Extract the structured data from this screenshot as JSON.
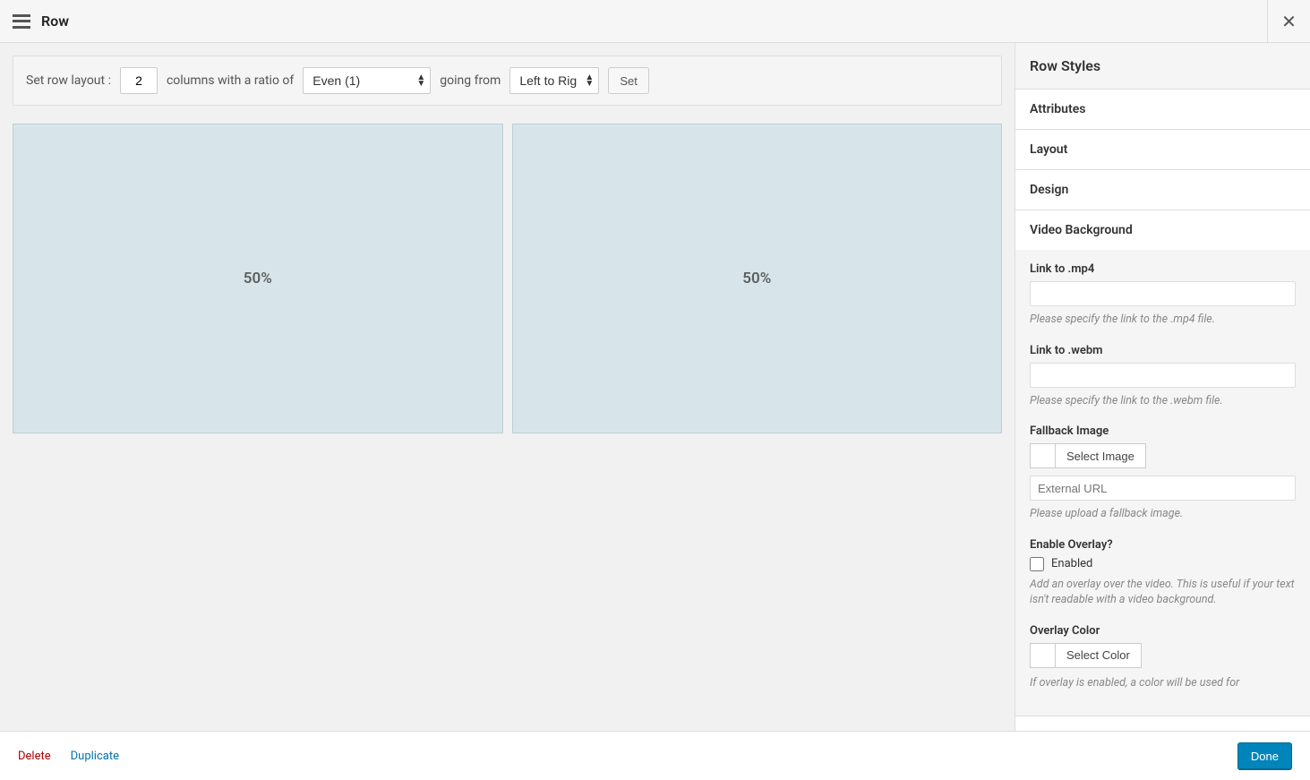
{
  "header": {
    "title": "Row"
  },
  "layoutBar": {
    "setLabel": "Set row layout :",
    "columnsValue": "2",
    "ratioText": "columns with a ratio of",
    "ratioSelected": "Even (1)",
    "goingText": "going from",
    "directionSelected": "Left to Right",
    "setButton": "Set"
  },
  "columns": [
    {
      "label": "50%"
    },
    {
      "label": "50%"
    }
  ],
  "sidebar": {
    "title": "Row Styles",
    "sections": {
      "attributes": "Attributes",
      "layout": "Layout",
      "design": "Design",
      "videoBg": "Video Background"
    },
    "videoBg": {
      "mp4": {
        "label": "Link to .mp4",
        "desc": "Please specify the link to the .mp4 file."
      },
      "webm": {
        "label": "Link to .webm",
        "desc": "Please specify the link to the .webm file."
      },
      "fallback": {
        "label": "Fallback Image",
        "selectBtn": "Select Image",
        "placeholder": "External URL",
        "desc": "Please upload a fallback image."
      },
      "overlay": {
        "label": "Enable Overlay?",
        "checkboxLabel": "Enabled",
        "desc": "Add an overlay over the video. This is useful if your text isn't readable with a video background."
      },
      "overlayColor": {
        "label": "Overlay Color",
        "selectBtn": "Select Color",
        "desc": "If overlay is enabled, a color will be used for"
      }
    }
  },
  "footer": {
    "delete": "Delete",
    "duplicate": "Duplicate",
    "done": "Done"
  }
}
